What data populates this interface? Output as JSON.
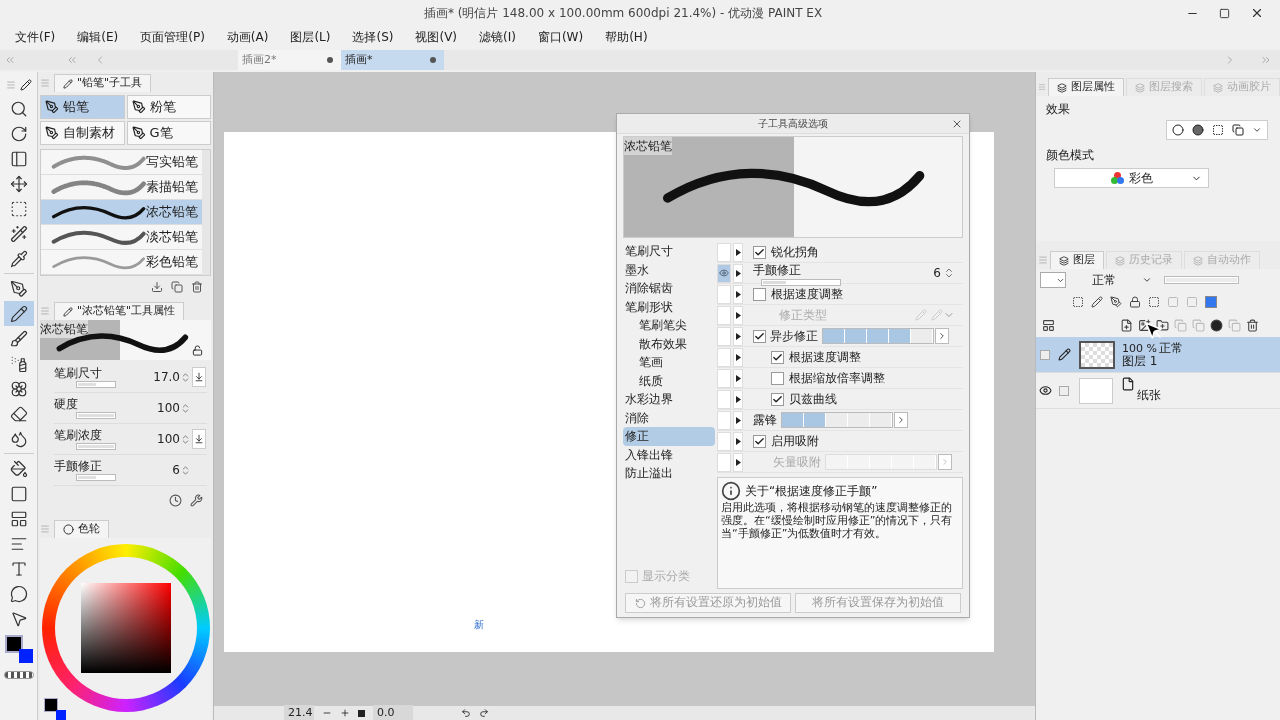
{
  "window": {
    "title": "插画* (明信片 148.00 x 100.00mm 600dpi 21.4%) - 优动漫 PAINT EX"
  },
  "menu": [
    "文件(F)",
    "编辑(E)",
    "页面管理(P)",
    "动画(A)",
    "图层(L)",
    "选择(S)",
    "视图(V)",
    "滤镜(I)",
    "窗口(W)",
    "帮助(H)"
  ],
  "doc_tabs": [
    {
      "label": "插画2*",
      "selected": false
    },
    {
      "label": "插画*",
      "selected": true
    }
  ],
  "tools": [
    {
      "kind": "zoom",
      "selected": false
    },
    {
      "kind": "rotate",
      "selected": false
    },
    {
      "kind": "view",
      "selected": false
    },
    {
      "kind": "move",
      "selected": false
    },
    {
      "kind": "select",
      "selected": false
    },
    {
      "kind": "wand",
      "selected": false
    },
    {
      "kind": "eyedropper",
      "selected": false
    },
    {
      "kind": "pen",
      "selected": false
    },
    {
      "kind": "pencil",
      "selected": true
    },
    {
      "kind": "brush",
      "selected": false
    },
    {
      "kind": "airbrush",
      "selected": false
    },
    {
      "kind": "decoration",
      "selected": false
    },
    {
      "kind": "eraser",
      "selected": false
    },
    {
      "kind": "blend",
      "selected": false
    },
    {
      "kind": "fill",
      "selected": false
    },
    {
      "kind": "gradient",
      "selected": false
    },
    {
      "kind": "frame",
      "selected": false
    },
    {
      "kind": "ruler",
      "selected": false
    },
    {
      "kind": "text",
      "selected": false
    },
    {
      "kind": "balloon",
      "selected": false
    },
    {
      "kind": "correct",
      "selected": false
    }
  ],
  "subtool_panel": {
    "title": "\"铅笔\"子工具",
    "groups": [
      {
        "label": "铅笔",
        "selected": true
      },
      {
        "label": "粉笔",
        "selected": false
      },
      {
        "label": "自制素材",
        "selected": false
      },
      {
        "label": "G笔",
        "selected": false
      }
    ],
    "brushes": [
      {
        "label": "写实铅笔",
        "selected": false
      },
      {
        "label": "素描铅笔",
        "selected": false
      },
      {
        "label": "浓芯铅笔",
        "selected": true
      },
      {
        "label": "淡芯铅笔",
        "selected": false
      },
      {
        "label": "彩色铅笔",
        "selected": false
      }
    ]
  },
  "tool_property": {
    "title": "\"浓芯铅笔\"工具属性",
    "preview_label": "浓芯铅笔",
    "properties": [
      {
        "label": "笔刷尺寸",
        "value": "17.0",
        "level": 0.5,
        "has_pin": true
      },
      {
        "label": "硬度",
        "value": "100",
        "level": 1,
        "has_pin": false
      },
      {
        "label": "笔刷浓度",
        "value": "100",
        "level": 1,
        "has_pin": true
      },
      {
        "label": "手颤修正",
        "value": "6",
        "level": 0.5,
        "has_pin": false
      }
    ]
  },
  "color_panel": {
    "title": "色轮"
  },
  "canvas": {
    "mark": "新"
  },
  "status_bar": {
    "zoom": "21.4",
    "angle": "0.0"
  },
  "dialog": {
    "title": "子工具高级选项",
    "preview_label": "浓芯铅笔",
    "categories": [
      {
        "label": "笔刷尺寸",
        "selected": false
      },
      {
        "label": "墨水",
        "selected": false
      },
      {
        "label": "消除锯齿",
        "selected": false
      },
      {
        "label": "笔刷形状",
        "selected": false,
        "children": [
          {
            "label": "笔刷笔尖",
            "selected": false
          },
          {
            "label": "散布效果",
            "selected": false
          },
          {
            "label": "笔画",
            "selected": false
          },
          {
            "label": "纸质",
            "selected": false
          }
        ]
      },
      {
        "label": "水彩边界",
        "selected": false
      },
      {
        "label": "消除",
        "selected": false
      },
      {
        "label": "修正",
        "selected": true
      },
      {
        "label": "入锋出锋",
        "selected": false
      },
      {
        "label": "防止溢出",
        "selected": false
      }
    ],
    "settings": [
      {
        "kind": "checkbox",
        "label": "锐化拐角",
        "checked": true,
        "eye": false
      },
      {
        "kind": "slider",
        "label": "手颤修正",
        "value": "6",
        "level": 0.3,
        "eye": true
      },
      {
        "kind": "checkbox",
        "label": "根据速度调整",
        "checked": false,
        "eye": false,
        "children": [
          {
            "kind": "select",
            "label": "修正类型",
            "disabled": true,
            "eye": false
          }
        ]
      },
      {
        "kind": "segments",
        "label": "异步修正",
        "checked": true,
        "level": 0.8,
        "disabled": false,
        "eye": false,
        "children": [
          {
            "kind": "checkbox",
            "label": "根据速度调整",
            "checked": true,
            "eye": false
          },
          {
            "kind": "checkbox",
            "label": "根据缩放倍率调整",
            "checked": false,
            "eye": false
          },
          {
            "kind": "checkbox",
            "label": "贝兹曲线",
            "checked": true,
            "eye": false
          }
        ]
      },
      {
        "kind": "segments",
        "label": "露锋",
        "level": 0.4,
        "disabled": false,
        "eye": false
      },
      {
        "kind": "checkbox",
        "label": "启用吸附",
        "checked": true,
        "eye": false
      },
      {
        "kind": "segments",
        "label": "矢量吸附",
        "level": 0,
        "disabled": true,
        "eye": false
      }
    ],
    "info_title": "关于“根据速度修正手颤”",
    "info_text": "启用此选项，将根据移动钢笔的速度调整修正的强度。在“缓慢绘制时应用修正”的情况下，只有当“手颤修正”为低数值时才有效。",
    "show_categories": {
      "label": "显示分类",
      "checked": false
    },
    "buttons": [
      "将所有设置还原为初始值",
      "将所有设置保存为初始值"
    ]
  },
  "layer_property": {
    "tabs": [
      {
        "label": "图层属性",
        "selected": true
      },
      {
        "label": "图层搜索",
        "selected": false
      },
      {
        "label": "动画胶片",
        "selected": false
      }
    ],
    "effect_label": "效果",
    "color_mode_label": "颜色模式",
    "color_mode": "彩色"
  },
  "layer_panel": {
    "tabs": [
      {
        "label": "图层",
        "selected": true
      },
      {
        "label": "历史记录",
        "selected": false
      },
      {
        "label": "自动动作",
        "selected": false
      }
    ],
    "blend_mode": "正常",
    "opacity_slider": {
      "level": 1
    },
    "layers": [
      {
        "kind": "raster",
        "opacity": "100 %",
        "blend": "正常",
        "name": "图层 1",
        "visible": false,
        "editing": true,
        "selected": true
      },
      {
        "kind": "paper",
        "name": "纸张",
        "visible": true,
        "editing": false,
        "selected": false
      }
    ]
  }
}
